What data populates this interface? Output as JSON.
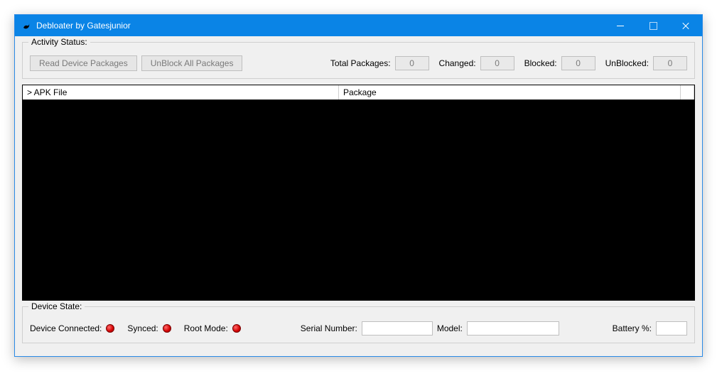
{
  "window": {
    "title": "Debloater by Gatesjunior"
  },
  "activity": {
    "legend": "Activity Status:",
    "read_btn": "Read Device Packages",
    "unblock_btn": "UnBlock All Packages",
    "total_label": "Total Packages:",
    "total_value": "0",
    "changed_label": "Changed:",
    "changed_value": "0",
    "blocked_label": "Blocked:",
    "blocked_value": "0",
    "unblocked_label": "UnBlocked:",
    "unblocked_value": "0"
  },
  "table": {
    "col_apk": "> APK File",
    "col_pkg": "Package"
  },
  "device": {
    "legend": "Device State:",
    "connected_label": "Device Connected:",
    "synced_label": "Synced:",
    "root_label": "Root Mode:",
    "serial_label": "Serial Number:",
    "serial_value": "",
    "model_label": "Model:",
    "model_value": "",
    "battery_label": "Battery %:",
    "battery_value": ""
  }
}
